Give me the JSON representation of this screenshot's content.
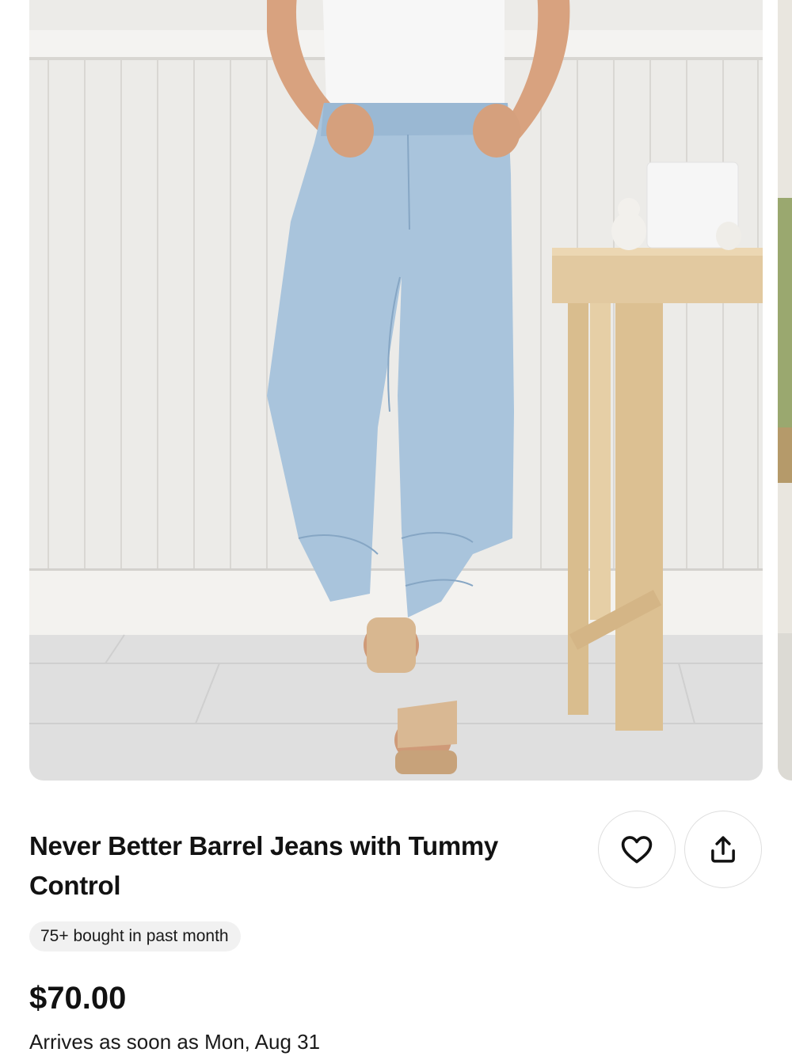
{
  "product": {
    "title": "Never Better Barrel Jeans with Tummy Control",
    "badge": "75+ bought in past month",
    "price": "$70.00",
    "arrival": "Arrives as soon as Mon, Aug 31"
  },
  "gallery": {
    "image_alt": "Model wearing light-wash barrel jeans with wedge sandals"
  },
  "actions": {
    "favorite_icon": "heart-icon",
    "share_icon": "share-icon"
  },
  "colors": {
    "text": "#111111",
    "badge_bg": "#f1f1f1",
    "denim": "#a9c4dc"
  }
}
